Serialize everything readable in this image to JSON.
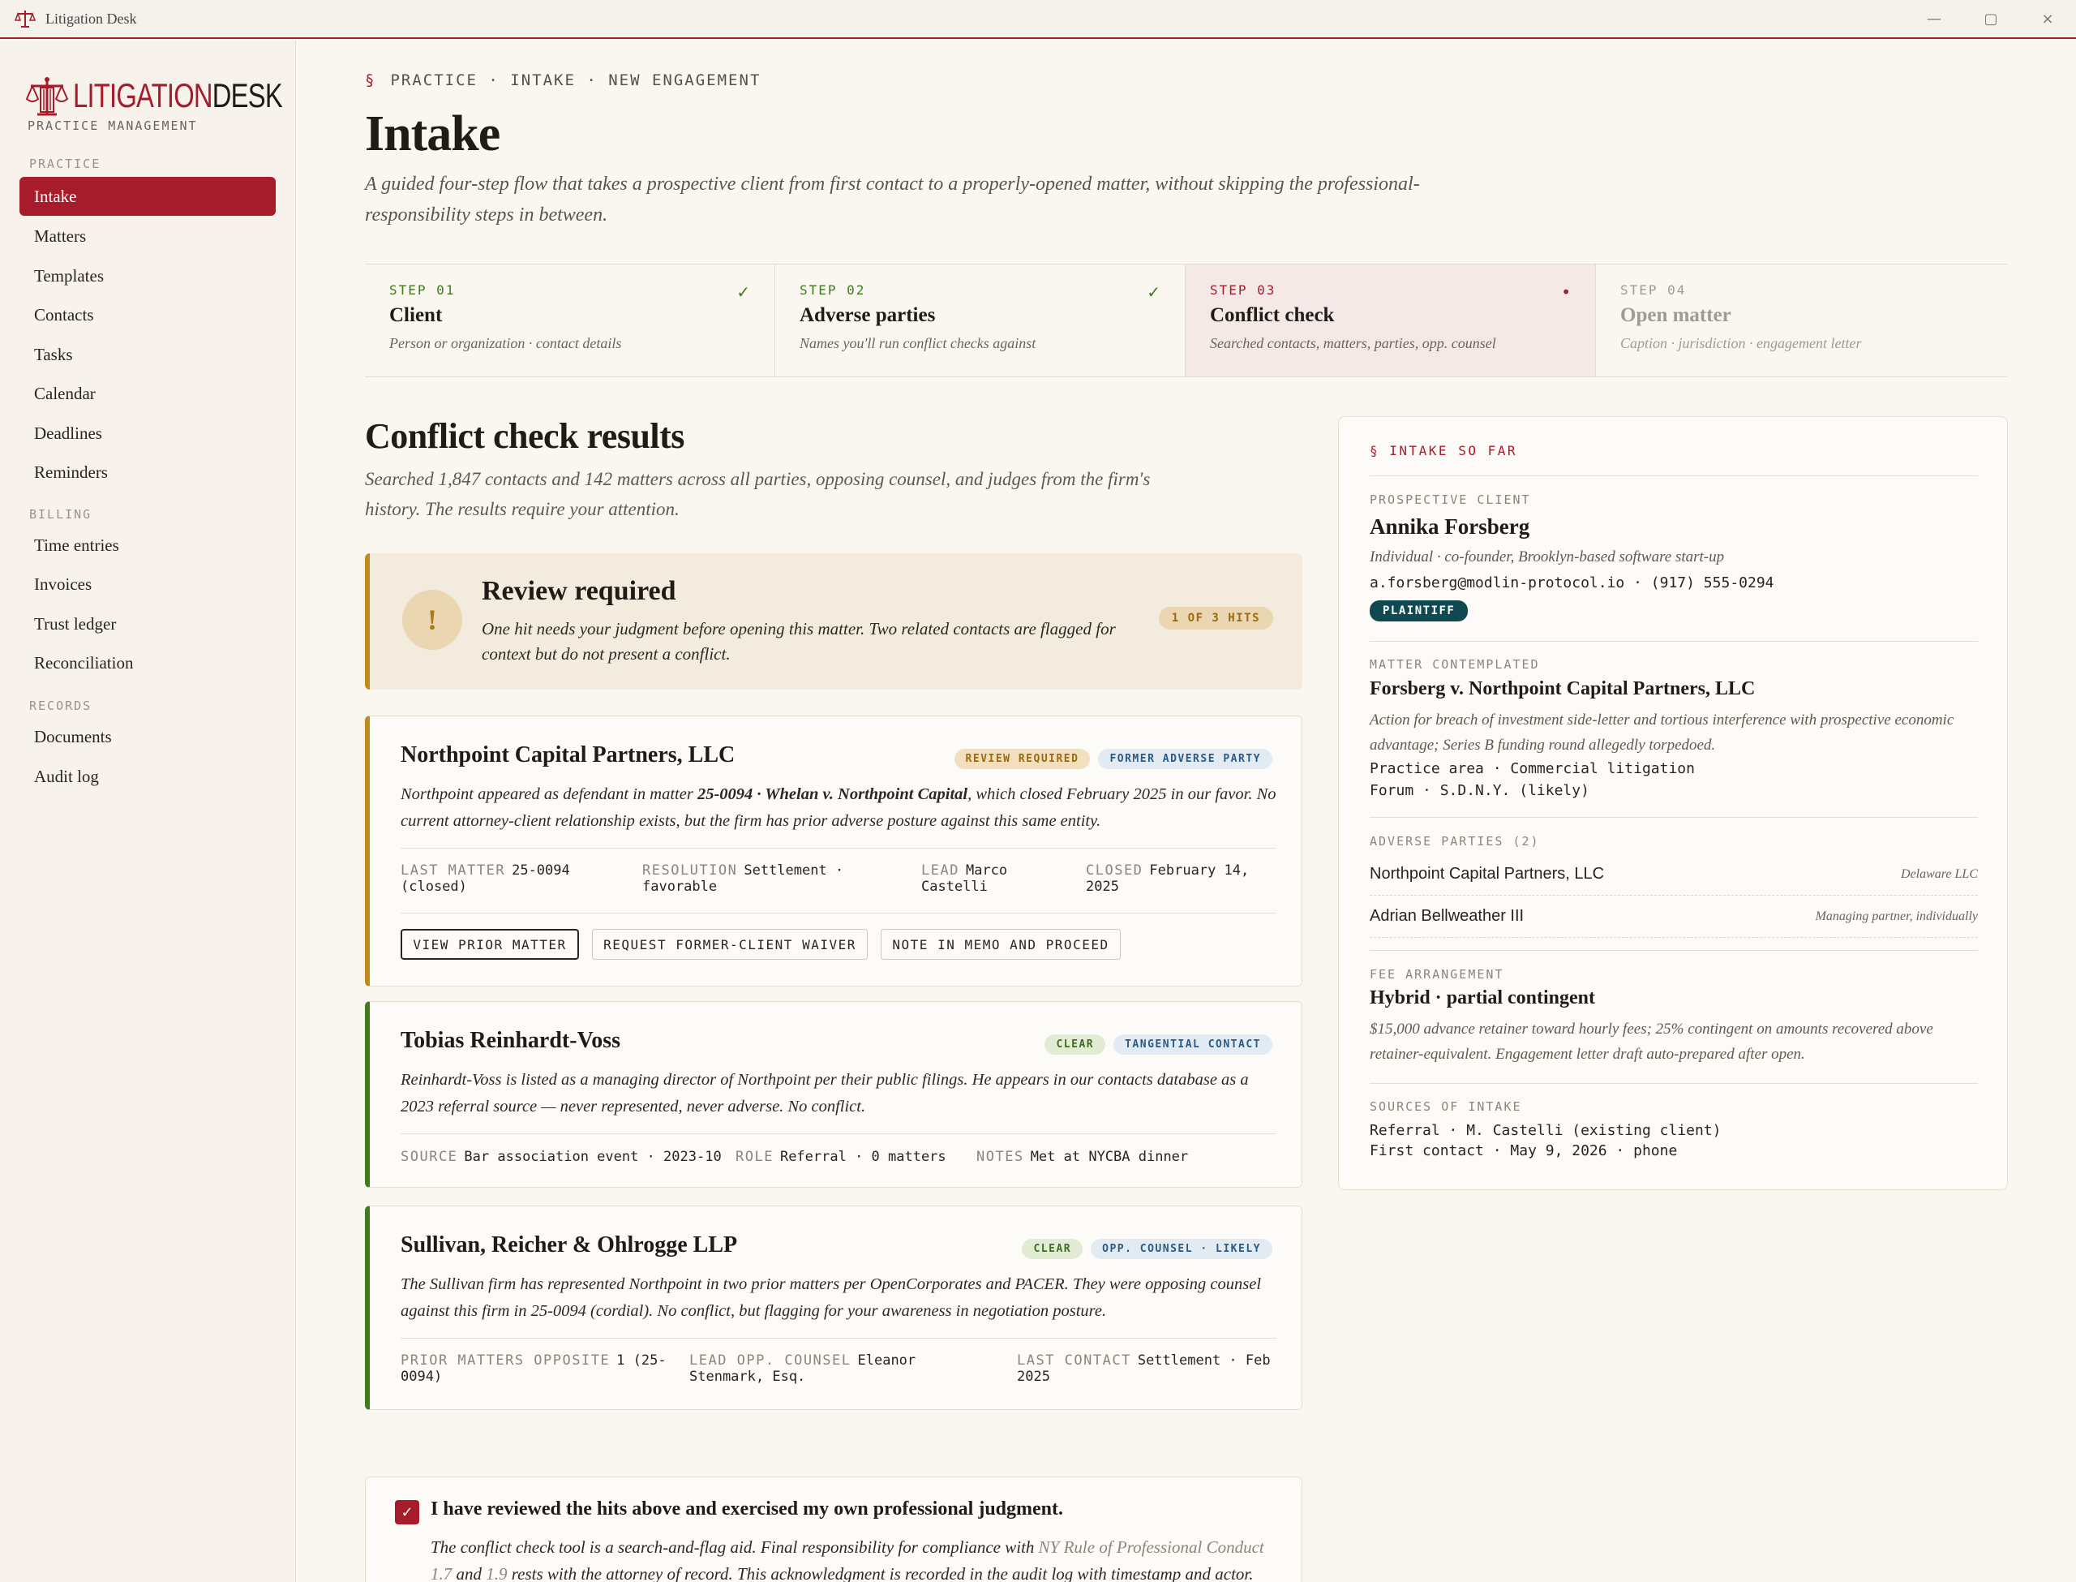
{
  "window": {
    "title": "Litigation Desk",
    "controls": [
      "—",
      "▢",
      "×"
    ]
  },
  "brand": {
    "name_a": "LITIGATION",
    "name_b": "DESK",
    "subtitle": "PRACTICE MANAGEMENT"
  },
  "sidebar": {
    "groups": [
      {
        "label": "PRACTICE",
        "items": [
          "Intake",
          "Matters",
          "Templates",
          "Contacts",
          "Tasks",
          "Calendar",
          "Deadlines",
          "Reminders"
        ]
      },
      {
        "label": "BILLING",
        "items": [
          "Time entries",
          "Invoices",
          "Trust ledger",
          "Reconciliation"
        ]
      },
      {
        "label": "RECORDS",
        "items": [
          "Documents",
          "Audit log"
        ]
      }
    ],
    "active": "Intake"
  },
  "breadcrumb": {
    "symbol": "§",
    "path": "PRACTICE · INTAKE · NEW ENGAGEMENT"
  },
  "page": {
    "title": "Intake",
    "subtitle": "A guided four-step flow that takes a prospective client from first contact to a properly-opened matter, without skipping the professional-responsibility steps in between."
  },
  "steps": [
    {
      "num": "STEP 01",
      "name": "Client",
      "desc": "Person or organization · contact details",
      "mark": "✓",
      "state": "done"
    },
    {
      "num": "STEP 02",
      "name": "Adverse parties",
      "desc": "Names you'll run conflict checks against",
      "mark": "✓",
      "state": "done"
    },
    {
      "num": "STEP 03",
      "name": "Conflict check",
      "desc": "Searched contacts, matters, parties, opp. counsel",
      "mark": "•",
      "state": "current"
    },
    {
      "num": "STEP 04",
      "name": "Open matter",
      "desc": "Caption · jurisdiction · engagement letter",
      "mark": "",
      "state": "todo"
    }
  ],
  "results": {
    "title": "Conflict check results",
    "subtitle": "Searched 1,847 contacts and 142 matters across all parties, opposing counsel, and judges from the firm's history. The results require your attention."
  },
  "alert": {
    "icon": "!",
    "title": "Review required",
    "text": "One hit needs your judgment before opening this matter. Two related contacts are flagged for context but do not present a conflict.",
    "pill": "1 OF 3 HITS"
  },
  "hits": [
    {
      "name": "Northpoint Capital Partners, LLC",
      "badges": [
        "REVIEW REQUIRED",
        "FORMER ADVERSE PARTY"
      ],
      "text_a": "Northpoint appeared as defendant in matter ",
      "text_b": "25-0094 · Whelan v. Northpoint Capital",
      "text_c": ", which closed February 2025 in our favor. No current attorney-client relationship exists, but the firm has prior adverse posture against this same entity.",
      "meta": [
        {
          "k": "LAST MATTER",
          "v": "25-0094",
          "v2": "(closed)"
        },
        {
          "k": "RESOLUTION",
          "v": "Settlement ·",
          "v2": "favorable"
        },
        {
          "k": "LEAD",
          "v": "Marco",
          "v2": "Castelli"
        },
        {
          "k": "CLOSED",
          "v": "February 14,",
          "v2": "2025"
        }
      ],
      "actions": [
        "VIEW PRIOR MATTER",
        "REQUEST FORMER-CLIENT WAIVER",
        "NOTE IN MEMO AND PROCEED"
      ]
    },
    {
      "name": "Tobias Reinhardt-Voss",
      "badges": [
        "CLEAR",
        "TANGENTIAL CONTACT"
      ],
      "text": "Reinhardt-Voss is listed as a managing director of Northpoint per their public filings. He appears in our contacts database as a 2023 referral source — never represented, never adverse. No conflict.",
      "meta": [
        {
          "k": "SOURCE",
          "v": "Bar association event · 2023-10"
        },
        {
          "k": "ROLE",
          "v": "Referral · 0 matters"
        },
        {
          "k": "NOTES",
          "v": "Met at NYCBA dinner"
        }
      ]
    },
    {
      "name": "Sullivan, Reicher & Ohlrogge LLP",
      "badges": [
        "CLEAR",
        "OPP. COUNSEL · LIKELY"
      ],
      "text": "The Sullivan firm has represented Northpoint in two prior matters per OpenCorporates and PACER. They were opposing counsel against this firm in 25-0094 (cordial). No conflict, but flagging for your awareness in negotiation posture.",
      "meta": [
        {
          "k": "PRIOR MATTERS OPPOSITE",
          "v": "1 (25-",
          "v2": "0094)"
        },
        {
          "k": "LEAD OPP. COUNSEL",
          "v": "Eleanor",
          "v2": "Stenmark, Esq."
        },
        {
          "k": "LAST CONTACT",
          "v": "Settlement · Feb",
          "v2": "2025"
        }
      ]
    }
  ],
  "ack": {
    "checked": "✓",
    "title": "I have reviewed the hits above and exercised my own professional judgment.",
    "text_a": "The conflict check tool is a search-and-flag aid. Final responsibility for compliance with ",
    "rule_a": "NY Rule of Professional Conduct 1.7",
    "text_b": " and ",
    "rule_b": "1.9",
    "text_c": " rests with the attorney of record. This acknowledgment is recorded in the audit log with timestamp and actor."
  },
  "summary": {
    "header": "§ INTAKE SO FAR",
    "client_label": "PROSPECTIVE CLIENT",
    "client_name": "Annika Forsberg",
    "client_desc": "Individual · co-founder, Brooklyn-based software start-up",
    "client_contact": "a.forsberg@modlin-protocol.io · (917) 555-0294",
    "client_role": "PLAINTIFF",
    "matter_label": "MATTER CONTEMPLATED",
    "matter_name": "Forsberg v. Northpoint Capital Partners, LLC",
    "matter_desc": "Action for breach of investment side-letter and tortious interference with prospective economic advantage; Series B funding round allegedly torpedoed.",
    "matter_area": "Practice area · Commercial litigation",
    "matter_forum": "Forum · S.D.N.Y. (likely)",
    "adverse_label": "ADVERSE PARTIES (2)",
    "adverse": [
      {
        "name": "Northpoint Capital Partners, LLC",
        "type": "Delaware LLC"
      },
      {
        "name": "Adrian Bellweather III",
        "type": "Managing partner, individually"
      }
    ],
    "fee_label": "FEE ARRANGEMENT",
    "fee_name": "Hybrid · partial contingent",
    "fee_desc": "$15,000 advance retainer toward hourly fees; 25% contingent on amounts recovered above retainer-equivalent. Engagement letter draft auto-prepared after open.",
    "sources_label": "SOURCES OF INTAKE",
    "source_1": "Referral · M. Castelli (existing client)",
    "source_2": "First contact · May 9, 2026 · phone"
  },
  "colors": {
    "accent": "#a71c2b",
    "warning": "#c08a1e",
    "clear": "#3f7a1e",
    "plaintiff": "#0f4a52"
  }
}
